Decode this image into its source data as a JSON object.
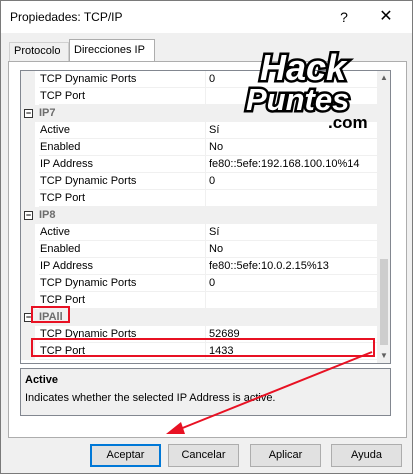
{
  "window": {
    "title": "Propiedades: TCP/IP",
    "help_glyph": "?",
    "close_glyph": "✕"
  },
  "tabs": [
    {
      "label": "Protocolo"
    },
    {
      "label": "Direcciones IP"
    }
  ],
  "grid": {
    "rows": [
      {
        "kind": "prop",
        "name": "TCP Dynamic Ports",
        "value": "0"
      },
      {
        "kind": "prop",
        "name": "TCP Port",
        "value": ""
      },
      {
        "kind": "cat",
        "name": "IP7",
        "toggle": "−"
      },
      {
        "kind": "prop",
        "name": "Active",
        "value": "Sí"
      },
      {
        "kind": "prop",
        "name": "Enabled",
        "value": "No"
      },
      {
        "kind": "prop",
        "name": "IP Address",
        "value": "fe80::5efe:192.168.100.10%14"
      },
      {
        "kind": "prop",
        "name": "TCP Dynamic Ports",
        "value": "0"
      },
      {
        "kind": "prop",
        "name": "TCP Port",
        "value": ""
      },
      {
        "kind": "cat",
        "name": "IP8",
        "toggle": "−"
      },
      {
        "kind": "prop",
        "name": "Active",
        "value": "Sí"
      },
      {
        "kind": "prop",
        "name": "Enabled",
        "value": "No"
      },
      {
        "kind": "prop",
        "name": "IP Address",
        "value": "fe80::5efe:10.0.2.15%13"
      },
      {
        "kind": "prop",
        "name": "TCP Dynamic Ports",
        "value": "0"
      },
      {
        "kind": "prop",
        "name": "TCP Port",
        "value": ""
      },
      {
        "kind": "cat",
        "name": "IPAll",
        "toggle": "−"
      },
      {
        "kind": "prop",
        "name": "TCP Dynamic Ports",
        "value": "52689"
      },
      {
        "kind": "prop",
        "name": "TCP Port",
        "value": "1433"
      }
    ]
  },
  "description": {
    "title": "Active",
    "text": "Indicates whether the selected IP Address is active."
  },
  "buttons": {
    "ok": "Aceptar",
    "cancel": "Cancelar",
    "apply": "Aplicar",
    "help": "Ayuda"
  },
  "logo": {
    "line1": "Hack",
    "line2": "Puntes",
    "line3": ".com"
  },
  "colors": {
    "highlight": "#e81123",
    "accent": "#0078d7"
  }
}
